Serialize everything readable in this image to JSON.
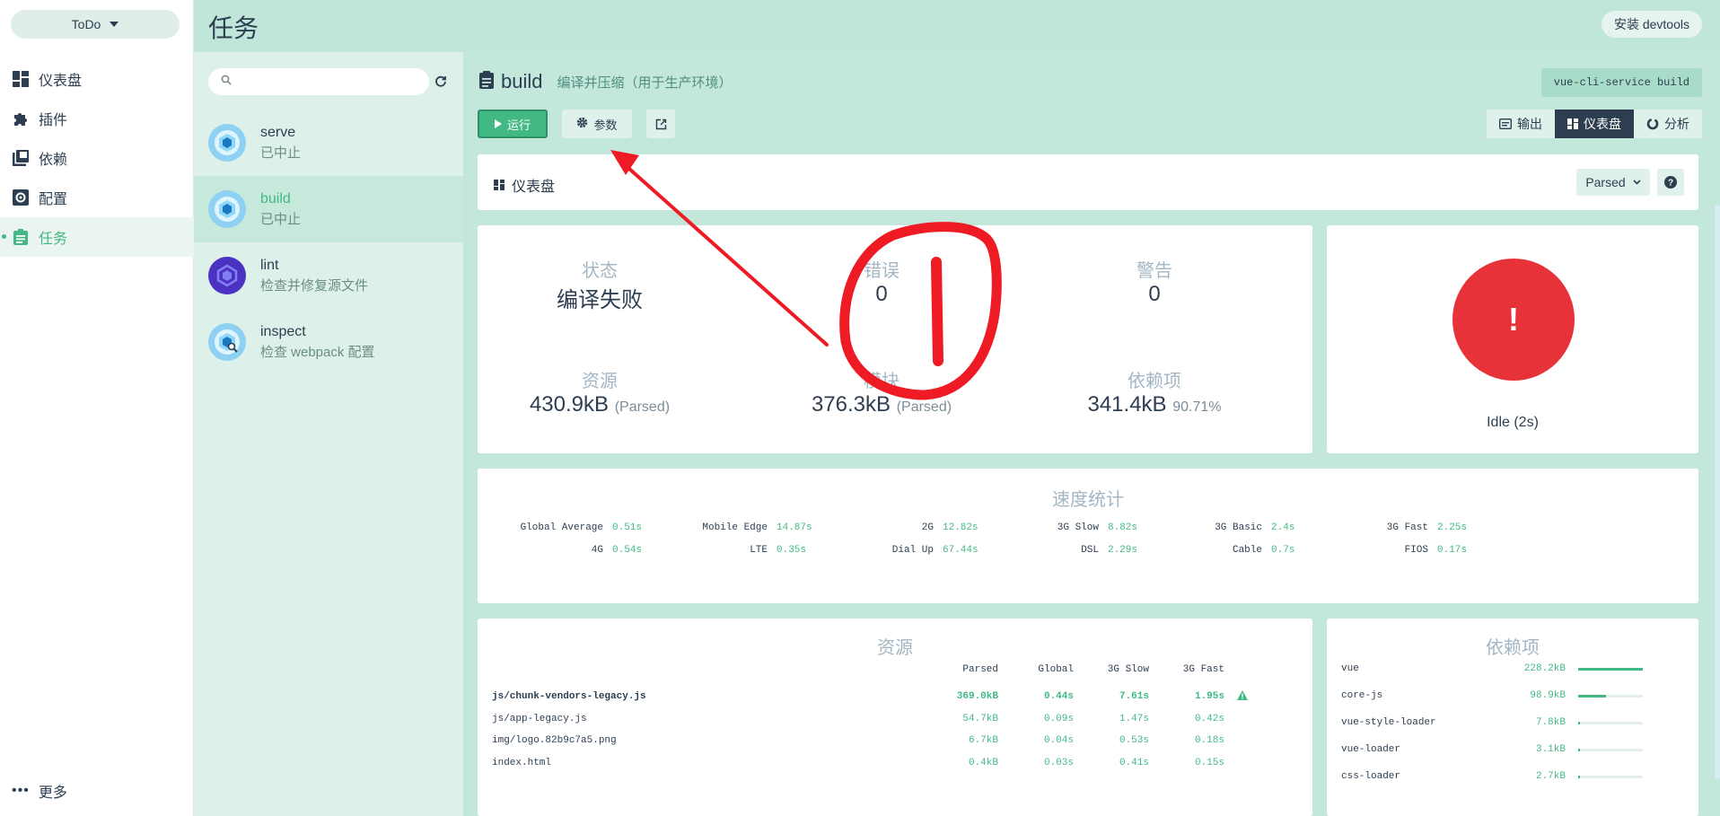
{
  "nav": {
    "project": "ToDo",
    "items": [
      {
        "label": "仪表盘",
        "icon": "dashboard-icon"
      },
      {
        "label": "插件",
        "icon": "puzzle-icon"
      },
      {
        "label": "依赖",
        "icon": "library-books-icon"
      },
      {
        "label": "配置",
        "icon": "settings-applications-icon"
      },
      {
        "label": "任务",
        "icon": "clipboard-icon",
        "active": true
      }
    ],
    "more": "更多"
  },
  "header": {
    "title": "任务",
    "devtools": "安装 devtools"
  },
  "tasks": {
    "search_placeholder": "",
    "items": [
      {
        "name": "serve",
        "desc": "已中止",
        "icon": "webpack-icon"
      },
      {
        "name": "build",
        "desc": "已中止",
        "icon": "webpack-icon",
        "selected": true
      },
      {
        "name": "lint",
        "desc": "检查并修复源文件",
        "icon": "eslint-icon"
      },
      {
        "name": "inspect",
        "desc": "检查 webpack 配置",
        "icon": "webpack-inspect-icon"
      }
    ]
  },
  "task": {
    "name": "build",
    "description": "编译并压缩（用于生产环境）",
    "command": "vue-cli-service build",
    "run": "运行",
    "params": "参数",
    "views": {
      "output": "输出",
      "dashboard": "仪表盘",
      "analyze": "分析"
    }
  },
  "dashboard": {
    "label": "仪表盘",
    "mode": "Parsed",
    "stats": {
      "status_label": "状态",
      "status_value": "编译失败",
      "errors_label": "错误",
      "errors_value": "0",
      "warnings_label": "警告",
      "warnings_value": "0",
      "assets_label": "资源",
      "assets_value": "430.9kB",
      "assets_note": "(Parsed)",
      "modules_label": "模块",
      "modules_value": "376.3kB",
      "modules_note": "(Parsed)",
      "deps_label": "依赖项",
      "deps_value": "341.4kB",
      "deps_note": "90.71%"
    },
    "status_card": {
      "symbol": "!",
      "text": "Idle (2s)"
    },
    "speed": {
      "title": "速度统计",
      "rows": [
        [
          [
            "Global Average",
            "0.51s"
          ],
          [
            "Mobile Edge",
            "14.87s"
          ],
          [
            "2G",
            "12.82s"
          ],
          [
            "3G Slow",
            "8.82s"
          ],
          [
            "3G Basic",
            "2.4s"
          ],
          [
            "3G Fast",
            "2.25s"
          ]
        ],
        [
          [
            "4G",
            "0.54s"
          ],
          [
            "LTE",
            "0.35s"
          ],
          [
            "Dial Up",
            "67.44s"
          ],
          [
            "DSL",
            "2.29s"
          ],
          [
            "Cable",
            "0.7s"
          ],
          [
            "FIOS",
            "0.17s"
          ]
        ]
      ]
    },
    "assets": {
      "title": "资源",
      "headers": [
        "Parsed",
        "Global",
        "3G Slow",
        "3G Fast"
      ],
      "rows": [
        {
          "name": "js/chunk-vendors-legacy.js",
          "cells": [
            "369.0kB",
            "0.44s",
            "7.61s",
            "1.95s"
          ],
          "warn": true
        },
        {
          "name": "js/app-legacy.js",
          "cells": [
            "54.7kB",
            "0.09s",
            "1.47s",
            "0.42s"
          ]
        },
        {
          "name": "img/logo.82b9c7a5.png",
          "cells": [
            "6.7kB",
            "0.04s",
            "0.53s",
            "0.18s"
          ]
        },
        {
          "name": "index.html",
          "cells": [
            "0.4kB",
            "0.03s",
            "0.41s",
            "0.15s"
          ]
        }
      ]
    },
    "deps": {
      "title": "依赖项",
      "rows": [
        {
          "name": "vue",
          "size": "228.2kB",
          "fraction": 1.0
        },
        {
          "name": "core-js",
          "size": "98.9kB",
          "fraction": 0.43
        },
        {
          "name": "vue-style-loader",
          "size": "7.8kB",
          "fraction": 0.034
        },
        {
          "name": "vue-loader",
          "size": "3.1kB",
          "fraction": 0.014
        },
        {
          "name": "css-loader",
          "size": "2.7kB",
          "fraction": 0.012
        }
      ]
    }
  },
  "colors": {
    "accent": "#42b983",
    "dark": "#2c3e50",
    "error": "#e8323a",
    "annotation": "#ee1b24"
  }
}
